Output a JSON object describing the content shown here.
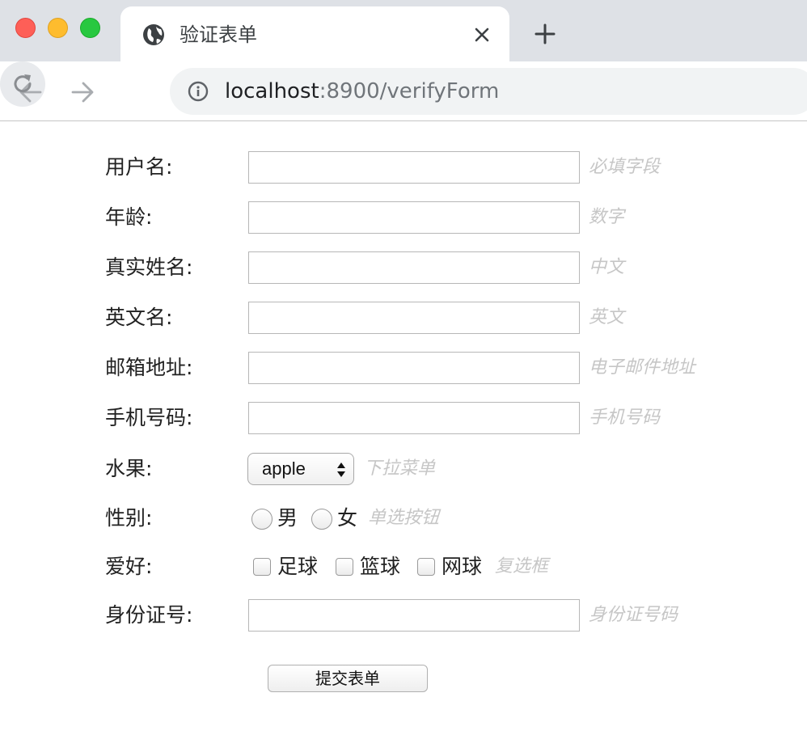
{
  "window": {
    "tab_title": "验证表单",
    "tab_favicon": "globe-icon",
    "url_host": "localhost",
    "url_rest": ":8900/verifyForm"
  },
  "form": {
    "username": {
      "label": "用户名:",
      "hint": "必填字段",
      "value": ""
    },
    "age": {
      "label": "年龄:",
      "hint": "数字",
      "value": ""
    },
    "real_name": {
      "label": "真实姓名:",
      "hint": "中文",
      "value": ""
    },
    "english_name": {
      "label": "英文名:",
      "hint": "英文",
      "value": ""
    },
    "email": {
      "label": "邮箱地址:",
      "hint": "电子邮件地址",
      "value": ""
    },
    "phone": {
      "label": "手机号码:",
      "hint": "手机号码",
      "value": ""
    },
    "fruit": {
      "label": "水果:",
      "selected": "apple",
      "hint": "下拉菜单"
    },
    "gender": {
      "label": "性别:",
      "options": [
        "男",
        "女"
      ],
      "hint": "单选按钮"
    },
    "hobbies": {
      "label": "爱好:",
      "options": [
        "足球",
        "篮球",
        "网球"
      ],
      "hint": "复选框"
    },
    "id_number": {
      "label": "身份证号:",
      "hint": "身份证号码",
      "value": ""
    },
    "submit_label": "提交表单"
  },
  "colors": {
    "hint": "#c6c6c6",
    "tabbar": "#dee1e6",
    "omnibox": "#f1f3f4"
  }
}
